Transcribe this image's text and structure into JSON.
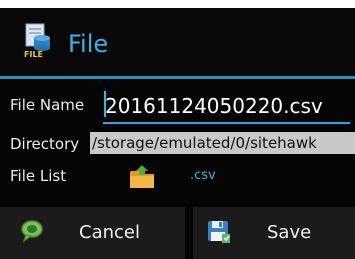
{
  "header": {
    "title": "File",
    "icon": "file-database-icon",
    "icon_caption": "FILE"
  },
  "form": {
    "file_name_label": "File Name",
    "file_name_value": "20161124050220.csv",
    "directory_label": "Directory",
    "directory_value": "/storage/emulated/0/sitehawk",
    "file_list_label": "File List",
    "file_list_icon": "folder-upload-icon",
    "file_extension": ".csv"
  },
  "buttons": {
    "cancel_label": "Cancel",
    "cancel_icon": "speech-bubble-icon",
    "save_label": "Save",
    "save_icon": "floppy-disk-icon"
  },
  "colors": {
    "accent": "#33b5e5",
    "background": "#050505",
    "button_background": "#1b1b1b",
    "directory_field": "#c9c9c9"
  }
}
